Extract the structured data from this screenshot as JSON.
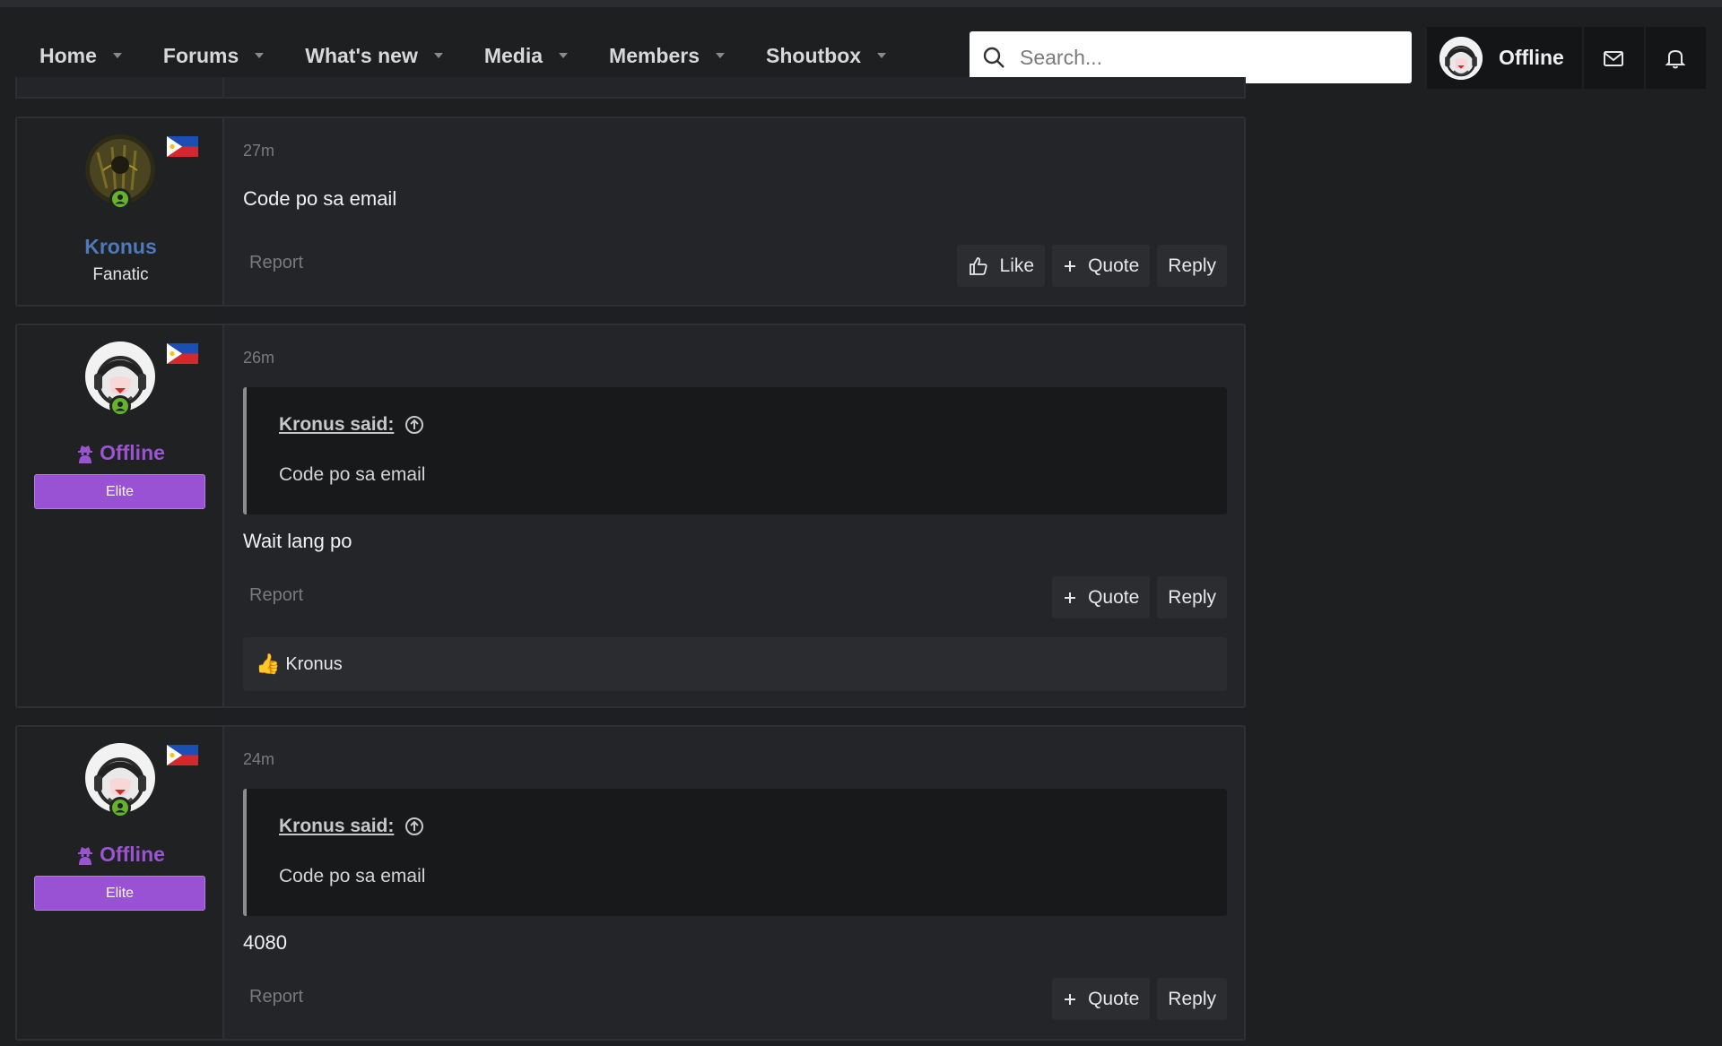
{
  "nav": {
    "items": [
      {
        "label": "Home"
      },
      {
        "label": "Forums"
      },
      {
        "label": "What's new"
      },
      {
        "label": "Media"
      },
      {
        "label": "Members"
      },
      {
        "label": "Shoutbox"
      }
    ],
    "search_placeholder": "Search...",
    "account_name": "Offline"
  },
  "posts": [
    {
      "username": "Kronus",
      "user_title": "Fanatic",
      "time": "27m",
      "message": "Code po sa email",
      "report": "Report",
      "like": "Like",
      "quote": "Quote",
      "reply": "Reply"
    },
    {
      "username": "Offline",
      "banner": "Elite",
      "time": "26m",
      "quote_author": "Kronus said:",
      "quote_text": "Code po sa email",
      "message": "Wait lang po",
      "report": "Report",
      "quote": "Quote",
      "reply": "Reply",
      "reaction_user": "Kronus"
    },
    {
      "username": "Offline",
      "banner": "Elite",
      "time": "24m",
      "quote_author": "Kronus said:",
      "quote_text": "Code po sa email",
      "message": "4080",
      "report": "Report",
      "quote": "Quote",
      "reply": "Reply"
    }
  ],
  "colors": {
    "background": "#1d1f21",
    "post_bg": "#232528",
    "username_blue": "#4f79b9",
    "elite_purple": "#9a52d4",
    "online_green": "#63b32b"
  }
}
